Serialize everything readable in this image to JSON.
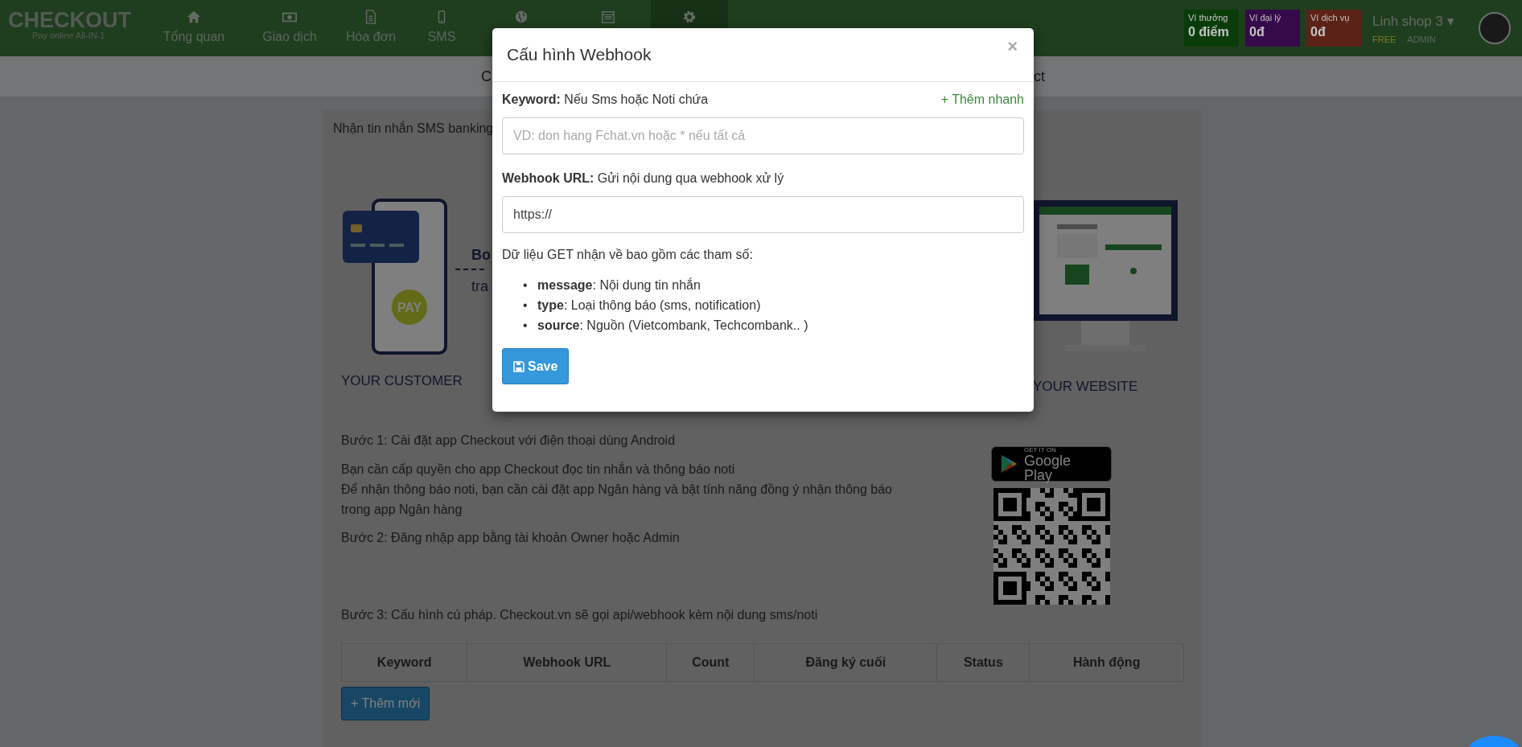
{
  "logo": {
    "name": "CHECKOUT",
    "tagline": "Pay online All-IN-1"
  },
  "nav": [
    {
      "label": "Tổng quan",
      "selected": false
    },
    {
      "label": "Giao dịch",
      "selected": false
    },
    {
      "label": "Hóa đơn",
      "selected": false
    },
    {
      "label": "SMS",
      "selected": false
    },
    {
      "selected": false
    },
    {
      "selected": false
    },
    {
      "selected": true
    }
  ],
  "wallets": [
    {
      "label": "Ví thưởng",
      "value": "0 điểm",
      "color": "#0a3c0a"
    },
    {
      "label": "Ví đại lý",
      "value": "0đ",
      "color": "#350a4b"
    },
    {
      "label": "Ví dịch vụ",
      "value": "0đ",
      "color": "#5c2217"
    }
  ],
  "user": {
    "name": "Linh shop 3",
    "caret": "▾",
    "plan": "FREE",
    "role": "ADMIN"
  },
  "sub_nav": {
    "left_text": "C",
    "right_text": "ct"
  },
  "intro": "Nhận tin nhắn SMS banking",
  "illustration": {
    "pay_label": "PAY",
    "customer_label": "YOUR CUSTOMER",
    "middle_texts": [
      "Bo",
      "tra"
    ],
    "website_label": "YOUR WEBSITE"
  },
  "steps": [
    {
      "kind": "step",
      "text": "Bước 1: Cài đặt app Checkout với điện thoại dùng Android"
    },
    {
      "kind": "note",
      "text": "Bạn cần cấp quyền cho app Checkout đọc tin nhắn và thông báo noti"
    },
    {
      "kind": "note",
      "text": "Để nhận thông báo noti, bạn cần cài đặt app Ngân hàng và bật tính năng đồng ý nhận thông báo trong app Ngân hàng"
    },
    {
      "kind": "step",
      "text": "Bước 2: Đăng nhập app bằng tài khoản Owner hoặc Admin"
    },
    {
      "kind": "gap"
    },
    {
      "kind": "step",
      "text": "Bước 3: Cấu hình cú pháp. Checkout.vn sẽ gọi api/webhook kèm nội dung sms/noti"
    }
  ],
  "google_play": {
    "small": "GET IT ON",
    "big": "Google Play"
  },
  "table": {
    "columns": [
      "Keyword",
      "Webhook URL",
      "Count",
      "Đăng ký cuối",
      "Status",
      "Hành động"
    ]
  },
  "add_button": "+ Thêm mới",
  "modal": {
    "title": "Cấu hình Webhook",
    "close": "×",
    "keyword_label": "**Keyword:** Nếu Sms hoặc Noti chứa",
    "quick_add": "+ Thêm nhanh",
    "keyword_placeholder": "VD: don hang Fchat.vn hoặc * nếu tất cả",
    "url_label": "**Webhook URL:** Gửi nội dung qua webhook xử lý",
    "url_value": "https://",
    "params_intro": "Dữ liệu GET nhận về bao gồm các tham số:",
    "bullet": "•",
    "params": [
      "**message**: Nội dung tin nhắn",
      "**type**: Loại thông báo (sms, notification)",
      "**source**: Nguồn (Vietcombank, Techcombank.. )"
    ],
    "save": "Save"
  }
}
